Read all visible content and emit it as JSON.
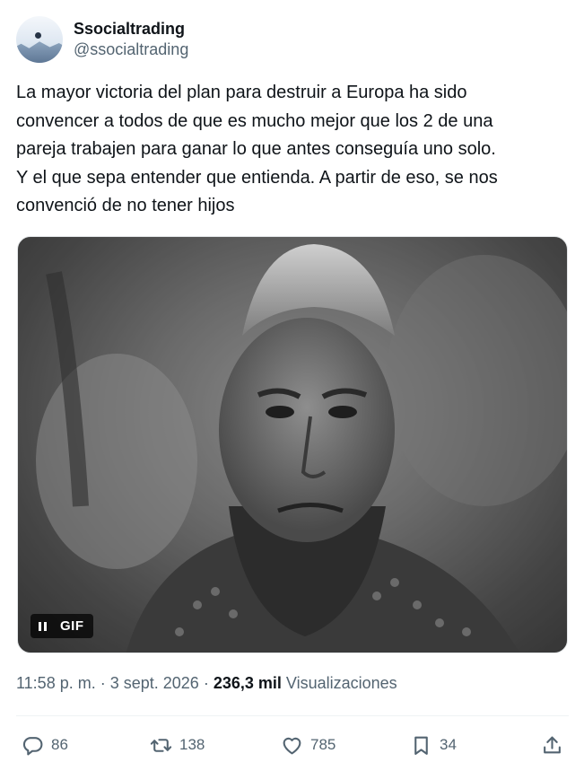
{
  "author": {
    "display_name": "Ssocialtrading",
    "handle": "@ssocialtrading"
  },
  "tweet": {
    "text": "La mayor victoria del plan para destruir a Europa ha sido\nconvencer a todos de que es mucho mejor que los 2 de una\npareja trabajen para ganar lo que antes conseguía uno solo.\nY el que sepa entender que entienda. A partir de eso, se nos\nconvenció de no tener hijos"
  },
  "media": {
    "type_label": "GIF"
  },
  "meta": {
    "time": "11:58 p. m.",
    "separator": " · ",
    "date": "3 sept. 2026",
    "views_count": "236,3 mil",
    "views_label": "Visualizaciones"
  },
  "actions": {
    "replies": "86",
    "reposts": "138",
    "likes": "785",
    "bookmarks": "34"
  },
  "icons": {
    "reply": "reply-icon",
    "repost": "repost-icon",
    "like": "heart-icon",
    "bookmark": "bookmark-icon",
    "share": "share-icon",
    "pause": "pause-icon"
  }
}
